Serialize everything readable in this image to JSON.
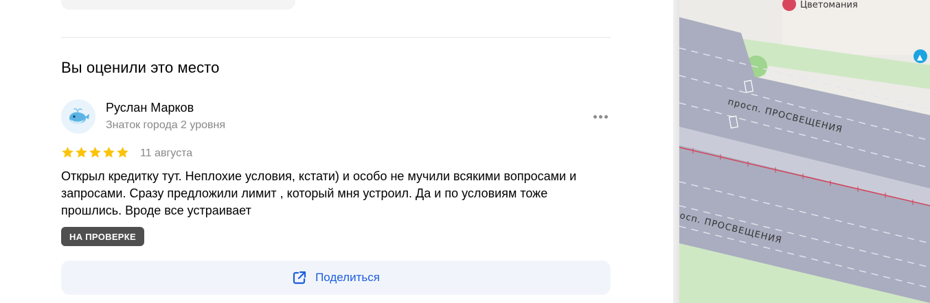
{
  "section": {
    "title": "Вы оценили это место"
  },
  "review": {
    "author_name": "Руслан Марков",
    "author_level": "Знаток города 2 уровня",
    "rating": 5,
    "rating_max": 5,
    "date": "11 августа",
    "text": "Открыл кредитку тут. Неплохие условия, кстати) и особо не мучили всякими вопросами и запросами. Сразу предложили лимит , который мня устроил. Да и по условиям тоже прошлись. Вроде все устраивает",
    "status_badge": "НА ПРОВЕРКЕ",
    "star_color": "#fcc30a"
  },
  "actions": {
    "share_label": "Поделиться"
  },
  "map": {
    "poi_label": "Цветомания",
    "street_label_1": "просп. ПРОСВЕЩЕНИЯ",
    "street_label_2": "осп. ПРОСВЕЩЕНИЯ"
  },
  "colors": {
    "accent": "#1e5dde",
    "badge_bg": "#4f4f4f"
  }
}
